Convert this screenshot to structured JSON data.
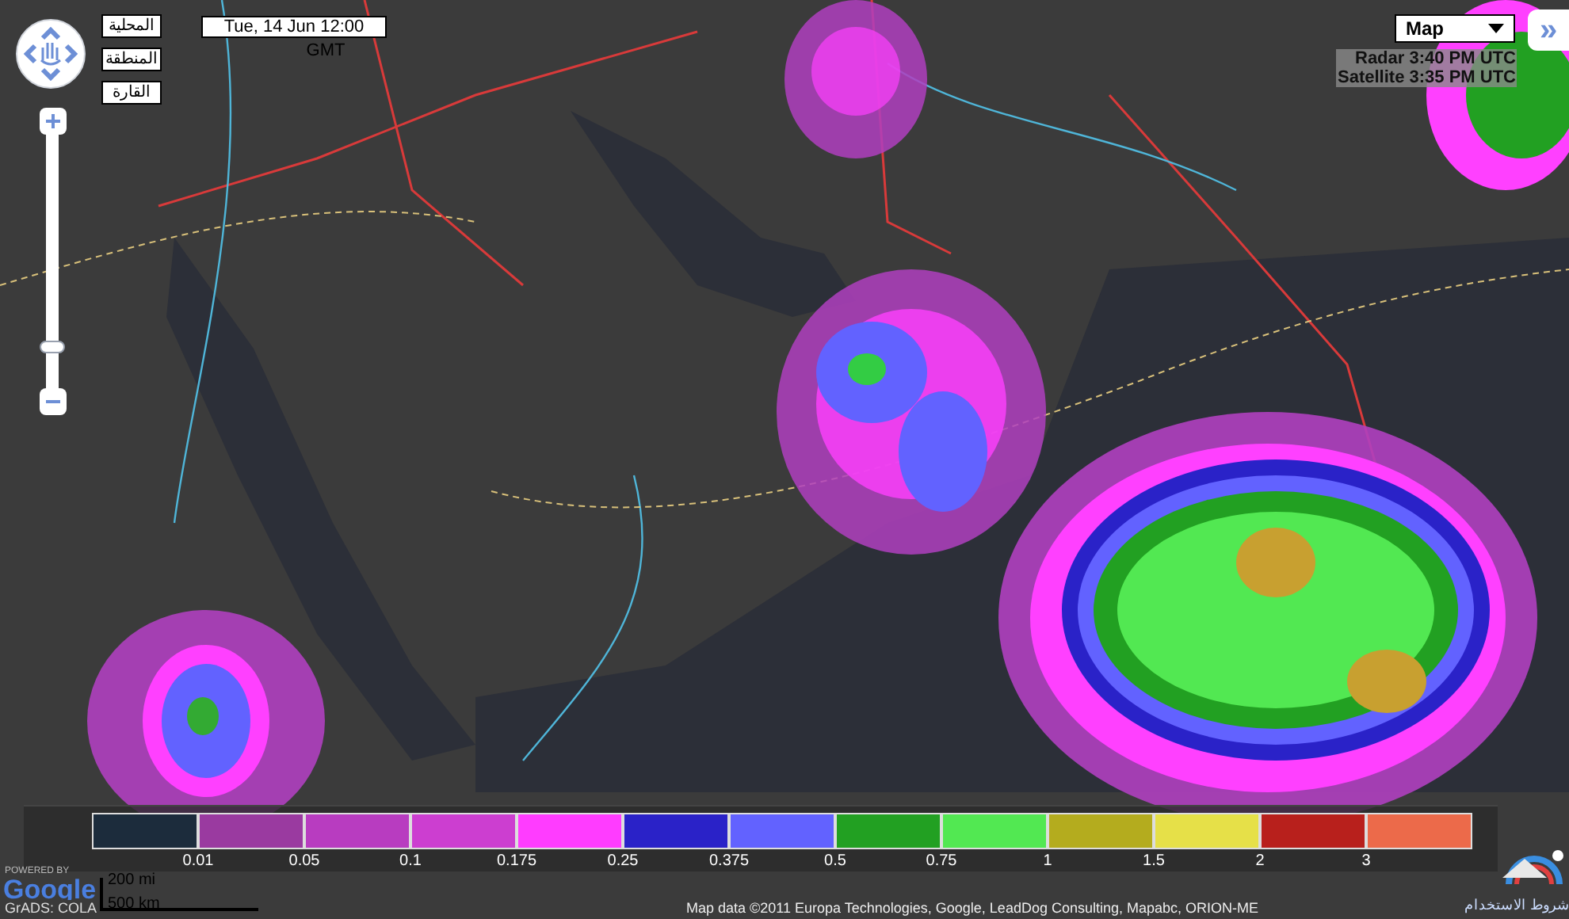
{
  "region_buttons": [
    {
      "label": "المحلية"
    },
    {
      "label": "المنطقة"
    },
    {
      "label": "القارة"
    }
  ],
  "time_box": {
    "date": "Tue, 14 Jun 12:00",
    "zone": "GMT"
  },
  "map_type": {
    "value": "Map"
  },
  "expand_button": {
    "label": "»"
  },
  "feed_times": [
    {
      "label": "Radar 3:40 PM UTC"
    },
    {
      "label": "Satellite 3:35 PM UTC"
    }
  ],
  "legend": {
    "swatches": [
      {
        "color": "#1c2c3c"
      },
      {
        "color": "#9a3aa0"
      },
      {
        "color": "#b83cc0"
      },
      {
        "color": "#cc3ed0"
      },
      {
        "color": "#ff3cff"
      },
      {
        "color": "#2a22c8"
      },
      {
        "color": "#6262ff"
      },
      {
        "color": "#22a022"
      },
      {
        "color": "#52e852"
      },
      {
        "color": "#b4ac1e"
      },
      {
        "color": "#e6e048"
      },
      {
        "color": "#b8201c"
      },
      {
        "color": "#ec6a4a"
      }
    ],
    "labels": [
      "0.01",
      "0.05",
      "0.1",
      "0.175",
      "0.25",
      "0.375",
      "0.5",
      "0.75",
      "1",
      "1.5",
      "2",
      "3"
    ]
  },
  "scale": {
    "miles": "200 mi",
    "km": "500 km"
  },
  "credits": {
    "powered": "POWERED BY",
    "logo": "Google",
    "grads": "GrADS: COLA",
    "attribution": "Map data ©2011 Europa Technologies, Google, LeadDog Consulting, Mapabc, ORION-ME",
    "terms": "شروط الاستخدام"
  }
}
